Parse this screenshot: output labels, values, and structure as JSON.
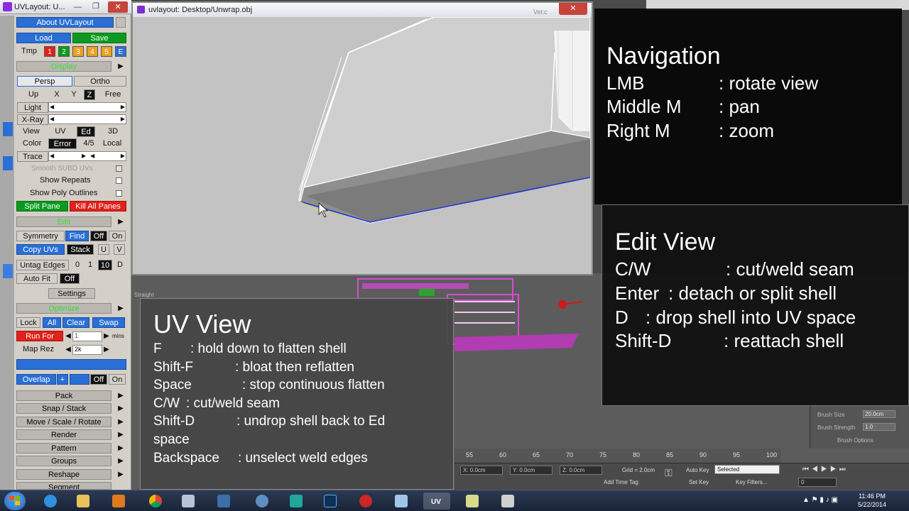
{
  "uvlayout_window": {
    "title": "UVLayout: U...",
    "min": "—",
    "max": "❐",
    "close": "✕"
  },
  "uvlayout_panel": {
    "about": "About UVLayout",
    "load": "Load",
    "save": "Save",
    "tmp": "Tmp",
    "tmp_slots": [
      "1",
      "2",
      "3",
      "4",
      "5",
      "E"
    ],
    "display_header": "Display",
    "persp": "Persp",
    "ortho": "Ortho",
    "up": "Up",
    "axes": [
      "X",
      "Y",
      "Z",
      "Free"
    ],
    "light": "Light",
    "xray": "X-Ray",
    "view": "View",
    "view_opts": [
      "UV",
      "Ed",
      "3D"
    ],
    "color": "Color",
    "color_opts": [
      "Error",
      "4/5",
      "Local"
    ],
    "trace": "Trace",
    "smooth": "Smooth SUBD UVs",
    "show_repeats": "Show Repeats",
    "show_poly": "Show Poly Outlines",
    "split_pane": "Split Pane",
    "kill_panes": "Kill All Panes",
    "edit_header": "Edit",
    "symmetry": "Symmetry",
    "find": "Find",
    "off": "Off",
    "on": "On",
    "copy_uvs": "Copy UVs",
    "stack": "Stack",
    "u": "U",
    "v": "V",
    "untag_edges": "Untag Edges",
    "untag_nums": [
      "0",
      "1",
      "10",
      "D"
    ],
    "auto_fit": "Auto Fit",
    "settings": "Settings",
    "optimize_header": "Optimize",
    "lock": "Lock",
    "all": "All",
    "clear": "Clear",
    "swap": "Swap",
    "run_for": "Run For",
    "run_for_value": "1",
    "mins": "mins",
    "map_rez": "Map Rez",
    "map_rez_value": "2k",
    "overlap": "Overlap",
    "plus": "+",
    "menus": [
      "Pack",
      "Snap / Stack",
      "Move / Scale / Rotate",
      "Render",
      "Pattern",
      "Groups",
      "Reshape",
      "Segment"
    ]
  },
  "viewport_window": {
    "title": "uvlayout: Desktop/Unwrap.obj",
    "close": "✕",
    "corner_label": "Vel:c"
  },
  "nav_overlay": {
    "title": "Navigation",
    "rows": [
      {
        "key": "LMB",
        "desc": ": rotate view"
      },
      {
        "key": "Middle M",
        "desc": ": pan"
      },
      {
        "key": "Right M",
        "desc": ": zoom"
      }
    ]
  },
  "edit_overlay": {
    "title": "Edit View",
    "rows": [
      {
        "key": "C/W",
        "desc": ": cut/weld seam"
      },
      {
        "key": "Enter",
        "desc": ": detach or split shell"
      },
      {
        "key": "D",
        "desc": ": drop shell into UV space"
      },
      {
        "key": "Shift-D",
        "desc": ": reattach shell"
      }
    ]
  },
  "uv_overlay": {
    "title": "UV View",
    "rows": [
      {
        "key": "F",
        "desc": ": hold down to flatten shell"
      },
      {
        "key": "Shift-F",
        "desc": ": bloat then reflatten"
      },
      {
        "key": "Space",
        "desc": ": stop continuous flatten"
      },
      {
        "key": "C/W",
        "desc": ": cut/weld seam"
      },
      {
        "key": "Shift-D",
        "desc": ": undrop shell back to Ed"
      },
      {
        "key": "space",
        "desc": ""
      },
      {
        "key": "Backspace",
        "desc": ": unselect weld edges"
      }
    ]
  },
  "max_status": {
    "ruler_ticks": [
      "55",
      "60",
      "65",
      "70",
      "75",
      "80",
      "85",
      "90",
      "95",
      "100"
    ],
    "x": "X: 0.0cm",
    "y": "Y: 0.0cm",
    "z": "Z: 0.0cm",
    "grid": "Grid = 2.0cm",
    "auto_key": "Auto Key",
    "selected": "Selected",
    "set_key": "Set Key",
    "key_filters": "Key Filters...",
    "frame": "0",
    "add_time_tag": "Add Time Tag",
    "brush_size": "Brush Size",
    "brush_size_value": "20.0cm",
    "brush_strength": "Brush Strength",
    "brush_strength_value": "1.0",
    "brush_options": "Brush Options",
    "straight": "Straight"
  },
  "taskbar": {
    "time": "11:46 PM",
    "date": "5/22/2014",
    "uv_label": "UV"
  },
  "colors": {
    "uv_blue": "#2a6fd6",
    "uv_green": "#0a9a1f",
    "uv_red": "#e0221b",
    "mesh_magenta": "#c23ac2"
  }
}
